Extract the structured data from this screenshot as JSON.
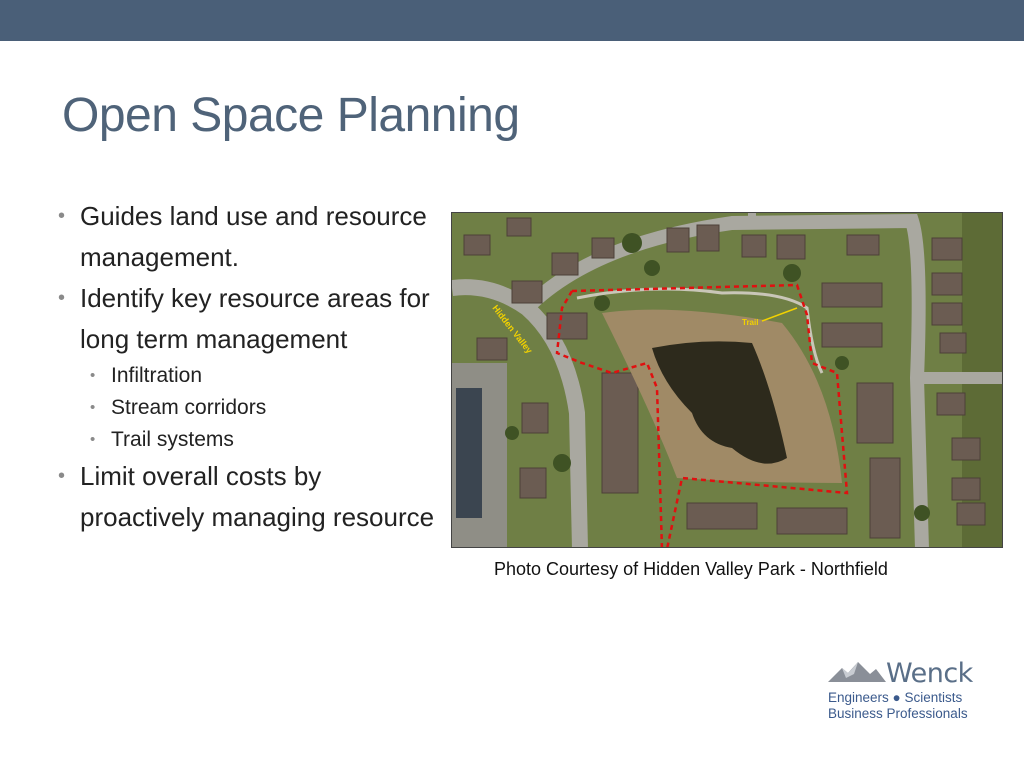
{
  "slide": {
    "title": "Open Space Planning",
    "bullets": [
      {
        "text": "Guides land use and resource management."
      },
      {
        "text": "Identify key resource areas for long term management"
      },
      {
        "text": "Limit overall costs by proactively managing resource"
      }
    ],
    "sub_bullets": [
      {
        "text": "Infiltration"
      },
      {
        "text": "Stream corridors"
      },
      {
        "text": "Trail systems"
      }
    ],
    "caption": "Photo Courtesy of Hidden Valley Park - Northfield"
  },
  "photo": {
    "street_label": "Hidden Valley",
    "trail_label": "Trail"
  },
  "logo": {
    "name": "Wenck",
    "line1": "Engineers ● Scientists",
    "line2": "Business Professionals"
  },
  "colors": {
    "header_band": "#4a5f78",
    "title": "#4f6379",
    "boundary": "#e01010",
    "logo_text": "#3b5a8c"
  }
}
